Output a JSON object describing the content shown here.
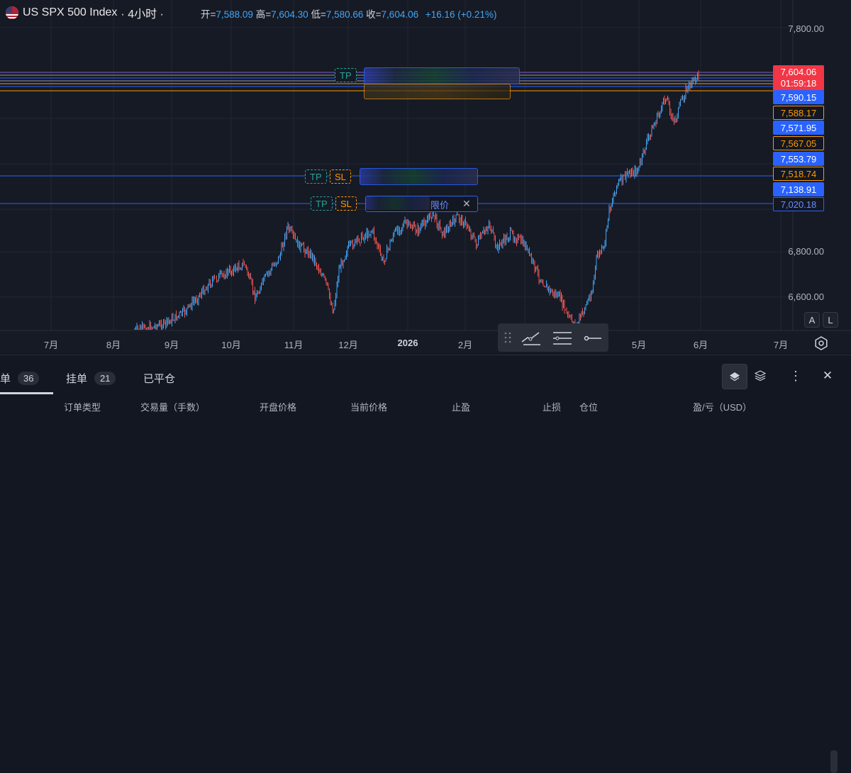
{
  "legend": {
    "symbol": "US SPX 500 Index",
    "interval": "· 4小时 ·",
    "open_label": "开=",
    "open": "7,588.09",
    "high_label": "高=",
    "high": "7,604.30",
    "low_label": "低=",
    "low": "7,580.66",
    "close_label": "收=",
    "close": "7,604.06",
    "change": "+16.16 (+0.21%)"
  },
  "price_axis": {
    "levels": [
      "7,800.00",
      "6,800.00",
      "6,600.00"
    ],
    "last_price": "7,604.06",
    "countdown": "01:59:18",
    "tags": [
      {
        "value": "7,590.15",
        "style": "blue"
      },
      {
        "value": "7,588.17",
        "style": "orange"
      },
      {
        "value": "7,571.95",
        "style": "blue"
      },
      {
        "value": "7,567.05",
        "style": "orange"
      },
      {
        "value": "7,553.79",
        "style": "blue"
      },
      {
        "value": "7,518.74",
        "style": "orange"
      },
      {
        "value": "7,138.91",
        "style": "blue"
      },
      {
        "value": "7,020.18",
        "style": "outline"
      }
    ]
  },
  "time_axis": [
    "7月",
    "8月",
    "9月",
    "10月",
    "11月",
    "12月",
    "2026",
    "2月",
    "5月",
    "6月",
    "7月"
  ],
  "orders": {
    "tp": "TP",
    "sl": "SL",
    "limit_text": "限价",
    "close_symbol": "✕"
  },
  "scale_buttons": {
    "auto": "A",
    "log": "L"
  },
  "icons": [
    "drawing-tools-icon",
    "settings-icon",
    "layers-icon",
    "more-icon",
    "close-icon"
  ],
  "bottom_panel": {
    "tabs": [
      {
        "label": "单",
        "count": "36"
      },
      {
        "label": "挂单",
        "count": "21"
      },
      {
        "label": "已平仓",
        "count": ""
      }
    ],
    "columns": [
      "订单类型",
      "交易量（手数）",
      "开盘价格",
      "当前价格",
      "止盈",
      "止损",
      "仓位",
      "盈/亏（USD）"
    ],
    "more": "⋮",
    "close": "✕"
  },
  "colors": {
    "background": "#161a25",
    "up": "#42a5f5",
    "down": "#ef5350",
    "accent_blue": "#2962ff",
    "orange": "#ff9800",
    "red": "#f23645"
  }
}
